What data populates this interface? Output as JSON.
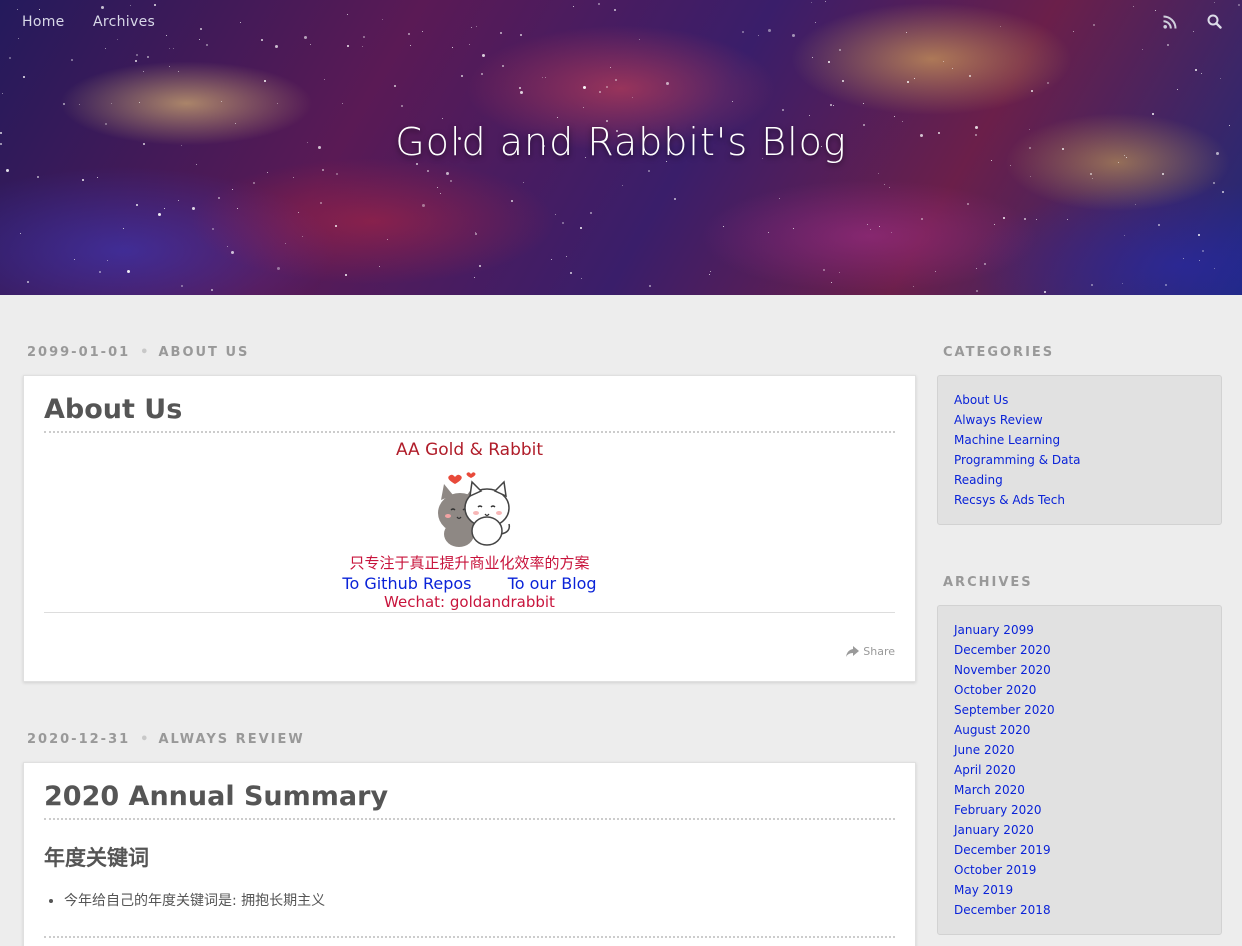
{
  "nav": {
    "home": "Home",
    "archives": "Archives",
    "rss_icon": "rss-icon",
    "search_icon": "search-icon"
  },
  "site_title": "Gold and Rabbit's Blog",
  "posts": [
    {
      "date": "2099-01-01",
      "category": "ABOUT US",
      "title": "About Us",
      "brand_line": "AA Gold & Rabbit",
      "image_name": "two-cats-hugging-sticker",
      "tagline": "只专注于真正提升商业化效率的方案",
      "link_github": "To Github Repos",
      "link_blog": "To our Blog",
      "wechat": "Wechat: goldandrabbit",
      "share": "Share"
    },
    {
      "date": "2020-12-31",
      "category": "ALWAYS REVIEW",
      "title": "2020 Annual Summary",
      "subheading": "年度关键词",
      "bullets": [
        "今年给自己的年度关键词是: 拥抱长期主义"
      ]
    }
  ],
  "sidebar": {
    "categories_title": "CATEGORIES",
    "categories": [
      "About Us",
      "Always Review",
      "Machine Learning",
      "Programming & Data",
      "Reading",
      "Recsys & Ads Tech"
    ],
    "archives_title": "ARCHIVES",
    "archives": [
      "January 2099",
      "December 2020",
      "November 2020",
      "October 2020",
      "September 2020",
      "August 2020",
      "June 2020",
      "April 2020",
      "March 2020",
      "February 2020",
      "January 2020",
      "December 2019",
      "October 2019",
      "May 2019",
      "December 2018"
    ]
  },
  "colors": {
    "link": "#0a23d8",
    "brand_red": "#b01d2a",
    "tagline": "#c8143c",
    "page_bg": "#ededed"
  }
}
